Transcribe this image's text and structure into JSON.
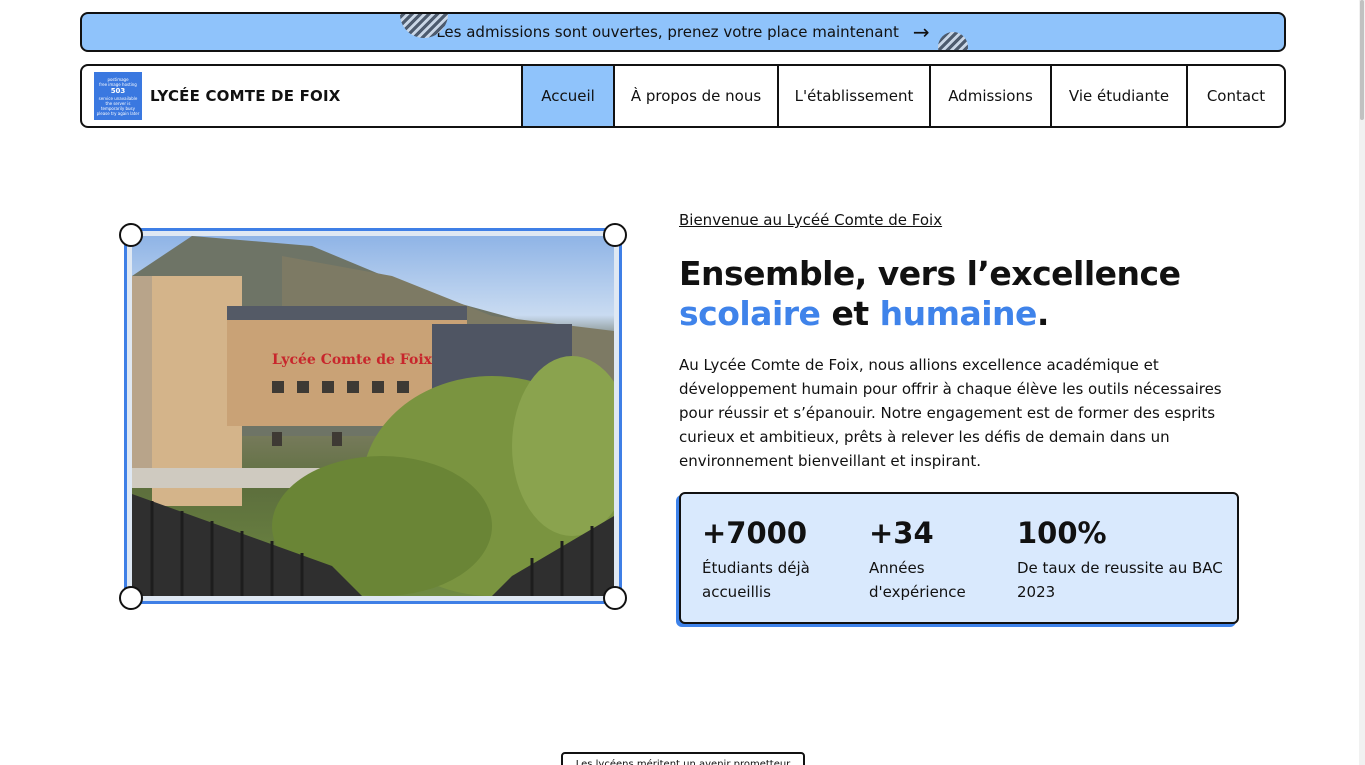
{
  "banner": {
    "text": "Les admissions sont ouvertes, prenez votre place maintenant",
    "arrow": "→"
  },
  "header": {
    "logo": {
      "line1": "postimage",
      "line2": "free image hosting",
      "code": "503",
      "line3": "service unavailable",
      "line4": "the server is temporarily busy",
      "line5": "please try again later"
    },
    "brand_name": "LYCÉE COMTE DE FOIX",
    "nav": [
      {
        "label": "Accueil",
        "active": true
      },
      {
        "label": "À propos de nous",
        "active": false
      },
      {
        "label": "L'établissement",
        "active": false
      },
      {
        "label": "Admissions",
        "active": false
      },
      {
        "label": "Vie étudiante",
        "active": false
      },
      {
        "label": "Contact",
        "active": false
      }
    ]
  },
  "hero": {
    "photo_sign": "Lycée Comte de Foix",
    "welcome_link": "Bienvenue au Lycéé Comte de Foix",
    "headline_line1": "Ensemble, vers l’excellence",
    "headline_word1": "scolaire",
    "headline_and": "et",
    "headline_word2": "humaine",
    "headline_period": ".",
    "intro": "Au Lycée Comte de Foix, nous allions excellence académique et développement humain pour offrir à chaque élève les outils nécessaires pour réussir et s’épanouir. Notre engagement est de former des esprits curieux et ambitieux, prêts à relever les défis de demain dans un environnement bienveillant et inspirant.",
    "stats": [
      {
        "value": "+7000",
        "label": "Étudiants déjà accueillis"
      },
      {
        "value": "+34",
        "label": "Années d'expérience"
      },
      {
        "value": "100%",
        "label": "De taux de reussite au BAC 2023"
      }
    ]
  },
  "next_section_tag": "Les lycéens méritent un avenir prometteur",
  "colors": {
    "accent_blue": "#8fc3fb",
    "highlight_blue": "#3f83ea",
    "stats_bg": "#d9e9fd"
  }
}
